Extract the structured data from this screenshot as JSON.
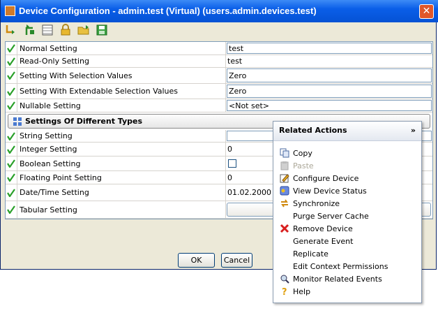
{
  "window": {
    "title": "Device Configuration - admin.test (Virtual) (users.admin.devices.test)",
    "close_glyph": "✕"
  },
  "toolbar": {
    "buttons": [
      {
        "name": "import-icon"
      },
      {
        "name": "export-icon"
      },
      {
        "name": "table-icon"
      },
      {
        "name": "lock-icon"
      },
      {
        "name": "open-folder-icon"
      },
      {
        "name": "save-icon"
      }
    ]
  },
  "settings": {
    "rows": [
      {
        "label": "Normal Setting",
        "value": "test"
      },
      {
        "label": "Read-Only Setting",
        "value": "test"
      },
      {
        "label": "Setting With Selection Values",
        "value": "Zero"
      },
      {
        "label": "Setting With Extendable Selection Values",
        "value": "Zero"
      },
      {
        "label": "Nullable Setting",
        "value": "<Not set>"
      }
    ],
    "group_title": "Settings Of Different Types",
    "typed_rows": [
      {
        "label": "String Setting",
        "value": ""
      },
      {
        "label": "Integer Setting",
        "value": "0"
      },
      {
        "label": "Boolean Setting",
        "value": ""
      },
      {
        "label": "Floating Point Setting",
        "value": "0"
      },
      {
        "label": "Date/Time Setting",
        "value": "01.02.2000 0"
      },
      {
        "label": "Tabular Setting",
        "value": ""
      }
    ]
  },
  "buttons": {
    "ok_label": "OK",
    "cancel_label": "Cancel"
  },
  "related_actions": {
    "title": "Related Actions",
    "chevron": "»",
    "items": [
      {
        "label": "Copy",
        "icon": "copy-icon",
        "disabled": false
      },
      {
        "label": "Paste",
        "icon": "paste-icon",
        "disabled": true
      },
      {
        "label": "Configure Device",
        "icon": "configure-icon",
        "disabled": false
      },
      {
        "label": "View Device Status",
        "icon": "status-icon",
        "disabled": false
      },
      {
        "label": "Synchronize",
        "icon": "synchronize-icon",
        "disabled": false
      },
      {
        "label": "Purge Server Cache",
        "icon": "",
        "disabled": false
      },
      {
        "label": "Remove Device",
        "icon": "remove-icon",
        "disabled": false
      },
      {
        "label": "Generate Event",
        "icon": "",
        "disabled": false
      },
      {
        "label": "Replicate",
        "icon": "",
        "disabled": false
      },
      {
        "label": "Edit Context Permissions",
        "icon": "",
        "disabled": false
      },
      {
        "label": "Monitor Related Events",
        "icon": "monitor-icon",
        "disabled": false
      },
      {
        "label": "Help",
        "icon": "help-icon",
        "disabled": false
      }
    ]
  },
  "colors": {
    "titlebar": "#0a5ee8",
    "check_green": "#2aa02a",
    "remove_red": "#d81e1e"
  }
}
